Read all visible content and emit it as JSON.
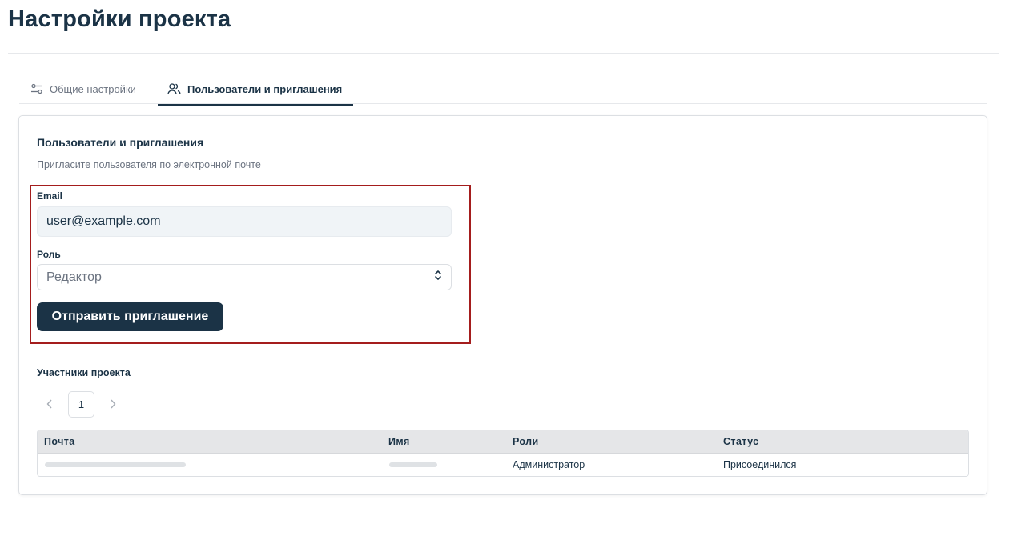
{
  "page": {
    "title": "Настройки проекта"
  },
  "tabs": [
    {
      "label": "Общие настройки",
      "icon": "sliders-icon",
      "active": false
    },
    {
      "label": "Пользователи и приглашения",
      "icon": "users-icon",
      "active": true
    }
  ],
  "invite": {
    "title": "Пользователи и приглашения",
    "subtitle": "Пригласите пользователя по электронной почте",
    "email_label": "Email",
    "email_value": "user@example.com",
    "role_label": "Роль",
    "role_value": "Редактор",
    "submit_label": "Отправить приглашение"
  },
  "members": {
    "title": "Участники проекта",
    "pagination": {
      "current_page": "1"
    },
    "columns": [
      "Почта",
      "Имя",
      "Роли",
      "Статус"
    ],
    "rows": [
      {
        "email": "",
        "name": "",
        "role": "Администратор",
        "status": "Присоединился"
      }
    ]
  },
  "colors": {
    "primary": "#1b3346",
    "highlight_border": "#a41d1d",
    "table_header_bg": "#e5e6e8",
    "input_bg": "#f0f4f7"
  }
}
